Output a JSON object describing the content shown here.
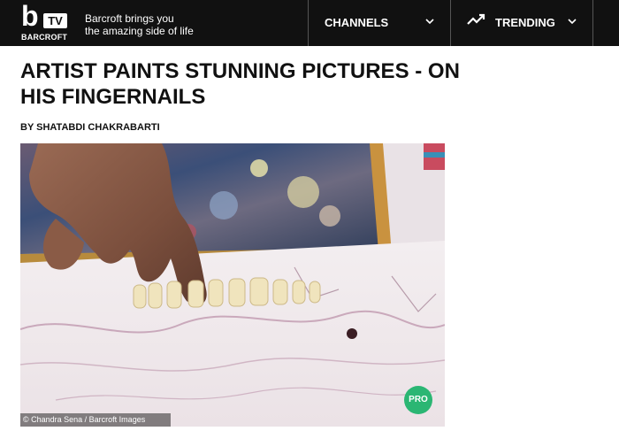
{
  "header": {
    "logo_text_b": "b",
    "logo_text_tv": "TV",
    "logo_brand": "BARCROFT",
    "tagline_line1": "Barcroft brings you",
    "tagline_line2": "the amazing side of life",
    "nav": [
      {
        "label": "CHANNELS",
        "icon": "chevron-down-icon"
      },
      {
        "label": "TRENDING",
        "icon": "trending-icon"
      }
    ]
  },
  "article": {
    "title": "ARTIST PAINTS STUNNING PICTURES - ON HIS FINGERNAILS",
    "byline": "BY SHATABDI CHAKRABARTI",
    "image_credit": "© Chandra Sena / Barcroft Images",
    "badge": "PRO"
  },
  "colors": {
    "topbar": "#111111",
    "accent_pro": "#2bb673"
  }
}
